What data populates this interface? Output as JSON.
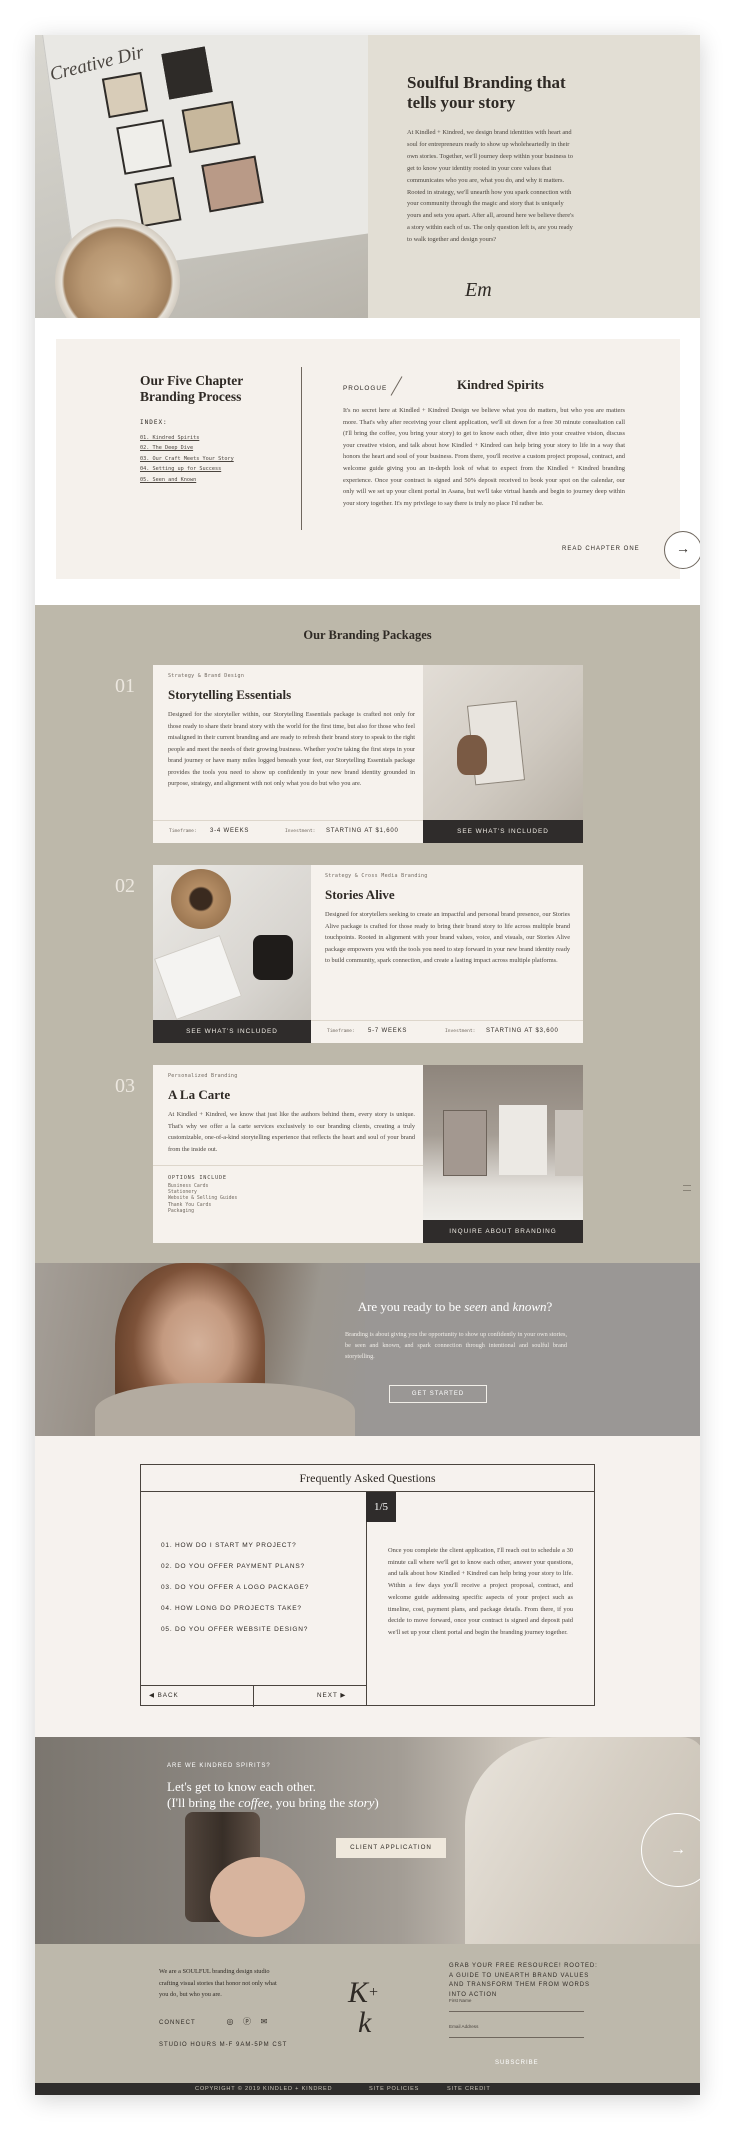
{
  "hero": {
    "image_title": "Creative Dir",
    "title": "Soulful Branding that tells your story",
    "paragraph": "At Kindled + Kindred, we design brand identities with heart and soul for entrepreneurs ready to show up wholeheartedly in their own stories. Together, we'll journey deep within your business to get to know your identity rooted in your core values that communicates who you are, what you do, and why it matters. Rooted in strategy, we'll unearth how you spark connection with your community through the magic and story that is uniquely yours and sets you apart. After all, around here we believe there's a story within each of us. The only question left is, are you ready to walk together and design yours?",
    "signature": "Em"
  },
  "chapter": {
    "title": "Our Five Chapter Branding Process",
    "index_label": "INDEX:",
    "index_items": [
      "01. Kindred Spirits",
      "02. The Deep Dive",
      "03. Our Craft Meets Your Story",
      "04. Setting up for Success",
      "05. Seen and Known"
    ],
    "prologue": "PROLOGUE",
    "heading": "Kindred Spirits",
    "paragraph": "It's no secret here at Kindled + Kindred Design we believe what you do matters, but who you are matters more. That's why after receiving your client application, we'll sit down for a free 30 minute consultation call (I'll bring the coffee, you bring your story) to get to know each other, dive into your creative vision, discuss your creative vision, and talk about how Kindled + Kindred can help bring your story to life in a way that honors the heart and soul of your business. From there, you'll receive a custom project proposal, contract, and welcome guide giving you an in-depth look of what to expect from the Kindled + Kindred branding experience. Once your contract is signed and 50% deposit received to book your spot on the calendar, our only will we set up your client portal in Asana, but we'll take virtual hands and begin to journey deep within your story together. It's my privilege to say there is truly no place I'd rather be.",
    "read_label": "READ CHAPTER ONE"
  },
  "packages": {
    "heading": "Our Branding Packages",
    "items": [
      {
        "num": "01",
        "tag": "Strategy & Brand Design",
        "title": "Storytelling Essentials",
        "paragraph": "Designed for the storyteller within, our Storytelling Essentials package is crafted not only for those ready to share their brand story with the world for the first time, but also for those who feel misaligned in their current branding and are ready to refresh their brand story to speak to the right people and meet the needs of their growing business. Whether you're taking the first steps in your brand journey or have many miles logged beneath your feet, our Storytelling Essentials package provides the tools you need to show up confidently in your new brand identity grounded in purpose, strategy, and alignment with not only what you do but who you are.",
        "timeframe_label": "Timeframe:",
        "timeframe": "3-4 WEEKS",
        "investment_label": "Investment:",
        "investment": "STARTING AT $1,600",
        "button": "SEE WHAT'S INCLUDED"
      },
      {
        "num": "02",
        "tag": "Strategy & Cross Media Branding",
        "title": "Stories Alive",
        "paragraph": "Designed for storytellers seeking to create an impactful and personal brand presence, our Stories Alive package is crafted for those ready to bring their brand story to life across multiple brand touchpoints. Rooted in alignment with your brand values, voice, and visuals, our Stories Alive package empowers you with the tools you need to step forward in your new brand identity ready to build community, spark connection, and create a lasting impact across multiple platforms.",
        "timeframe_label": "Timeframe:",
        "timeframe": "5-7 WEEKS",
        "investment_label": "Investment:",
        "investment": "STARTING AT $3,600",
        "button": "SEE WHAT'S INCLUDED"
      },
      {
        "num": "03",
        "tag": "Personalized Branding",
        "title": "A La Carte",
        "paragraph": "At Kindled + Kindred, we know that just like the authors behind them, every story is unique. That's why we offer a la carte services exclusively to our branding clients, creating a truly customizable, one-of-a-kind storytelling experience that reflects the heart and soul of your brand from the inside out.",
        "options_label": "OPTIONS INCLUDE",
        "options": [
          "Business Cards",
          "Stationery",
          "Website & Selling Guides",
          "Thank You Cards",
          "Packaging"
        ],
        "button": "INQUIRE ABOUT BRANDING"
      }
    ]
  },
  "cta": {
    "heading_plain": "Are you ready to be ",
    "heading_em1": "seen",
    "heading_and": " and ",
    "heading_em2": "known",
    "heading_q": "?",
    "paragraph": "Branding is about giving you the opportunity to show up confidently in your own stories, be seen and known, and spark connection through intentional and soulful brand storytelling.",
    "button": "GET STARTED"
  },
  "faq": {
    "title": "Frequently Asked Questions",
    "badge": "1/5",
    "questions": [
      "01. HOW DO I START MY PROJECT?",
      "02. DO YOU OFFER PAYMENT PLANS?",
      "03. DO YOU OFFER A LOGO PACKAGE?",
      "04. HOW LONG DO PROJECTS TAKE?",
      "05. DO YOU OFFER WEBSITE DESIGN?"
    ],
    "answer": "Once you complete the client application, I'll reach out to schedule a 30 minute call where we'll get to know each other, answer your questions, and talk about how Kindled + Kindred can help bring your story to life. Within a few days you'll receive a project proposal, contract, and welcome guide addressing specific aspects of your project such as timeline, cost, payment plans, and package details. From there, if you decide to move forward, once your contract is signed and deposit paid we'll set up your client portal and begin the branding journey together.",
    "back": "BACK",
    "next": "NEXT"
  },
  "kindred": {
    "tag": "ARE WE KINDRED SPIRITS?",
    "line1": "Let's get to know each other.",
    "line2_a": "(I'll bring the ",
    "line2_em1": "coffee",
    "line2_b": ", you bring the ",
    "line2_em2": "story",
    "line2_c": ")",
    "button": "CLIENT APPLICATION"
  },
  "footer": {
    "about": "We are a SOULFUL branding design studio crafting visual stories that honor not only what you do, but who you are.",
    "connect": "CONNECT",
    "hours": "STUDIO HOURS M-F 9AM-5PM CST",
    "free_resource": "GRAB YOUR FREE RESOURCE! ROOTED: A GUIDE TO UNEARTH BRAND VALUES AND TRANSFORM THEM FROM WORDS INTO ACTION",
    "first_name_placeholder": "First Name",
    "email_placeholder": "Email Address",
    "subscribe": "SUBSCRIBE",
    "copyright": "COPYRIGHT © 2019 KINDLED + KINDRED",
    "policies": "SITE POLICIES",
    "credit": "SITE CREDIT"
  }
}
